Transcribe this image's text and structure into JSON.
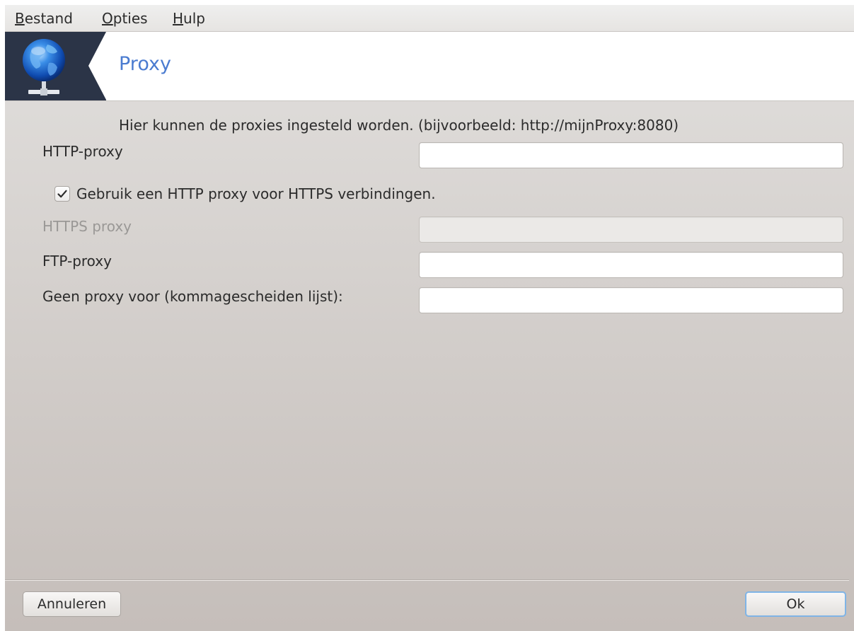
{
  "menubar": {
    "items": [
      {
        "mnemonic": "B",
        "rest": "estand"
      },
      {
        "mnemonic": "O",
        "rest": "pties"
      },
      {
        "mnemonic": "H",
        "rest": "ulp"
      }
    ]
  },
  "banner": {
    "title": "Proxy",
    "icon": "network-globe-icon"
  },
  "form": {
    "description": "Hier kunnen de proxies ingesteld worden. (bijvoorbeeld: http://mijnProxy:8080)",
    "http_proxy_label": "HTTP-proxy",
    "http_proxy_value": "",
    "use_http_for_https_label": "Gebruik een HTTP proxy voor HTTPS verbindingen.",
    "use_http_for_https_checked": true,
    "https_proxy_label": "HTTPS proxy",
    "https_proxy_value": "",
    "ftp_proxy_label": "FTP-proxy",
    "ftp_proxy_value": "",
    "no_proxy_label": "Geen proxy voor (kommagescheiden lijst):",
    "no_proxy_value": ""
  },
  "buttons": {
    "cancel_label": "Annuleren",
    "ok_label": "Ok"
  },
  "colors": {
    "accent": "#4a7bd0",
    "banner_icon_bg": "#2b3447",
    "focus_ring": "#7fb4e6"
  }
}
